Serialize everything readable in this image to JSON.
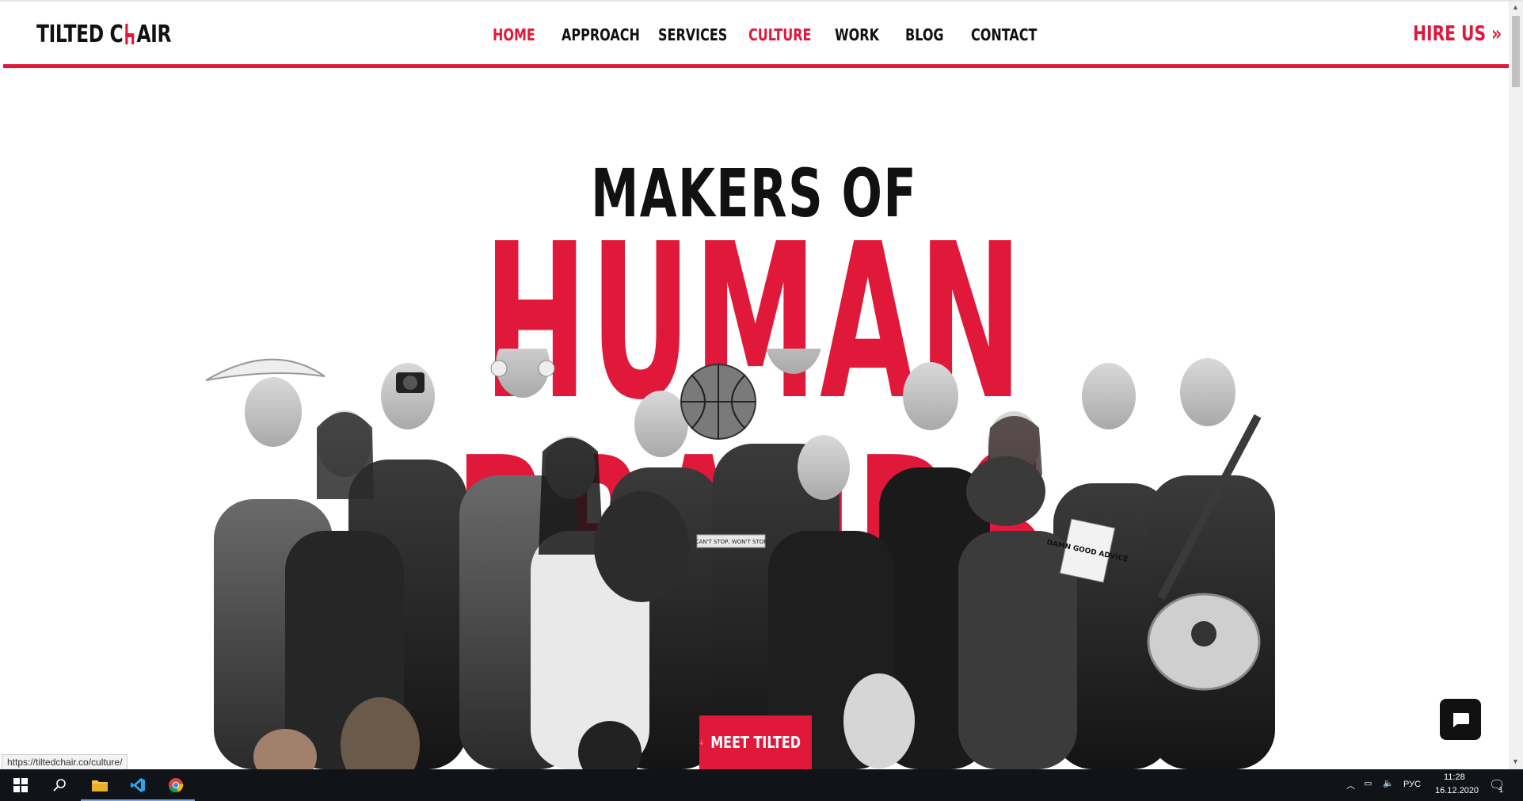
{
  "site": {
    "logo_text_left": "TILTED C",
    "logo_text_right": "AIR"
  },
  "nav": {
    "items": [
      {
        "label": "HOME",
        "active": true
      },
      {
        "label": "APPROACH",
        "active": false
      },
      {
        "label": "SERVICES",
        "active": false
      },
      {
        "label": "CULTURE",
        "active": true
      },
      {
        "label": "WORK",
        "active": false
      },
      {
        "label": "BLOG",
        "active": false
      },
      {
        "label": "CONTACT",
        "active": false
      }
    ],
    "hire_label": "HIRE US »"
  },
  "hero": {
    "line1": "MAKERS OF",
    "line2": "HUMAN BRANDS",
    "mug_text": "CAN'T STOP, WON'T STOP",
    "book_text": "DAMN GOOD ADVICE",
    "cta_label": "MEET TILTED"
  },
  "browser": {
    "status_url": "https://tiltedchair.co/culture/"
  },
  "taskbar": {
    "apps": [
      "start-icon",
      "search-icon",
      "file-explorer-icon",
      "vscode-icon",
      "chrome-icon"
    ],
    "language": "РУС",
    "time": "11:28",
    "date": "16.12.2020",
    "notification_count": "1"
  },
  "colors": {
    "brand_red": "#e0183a",
    "text_dark": "#111111",
    "taskbar": "#101318"
  }
}
